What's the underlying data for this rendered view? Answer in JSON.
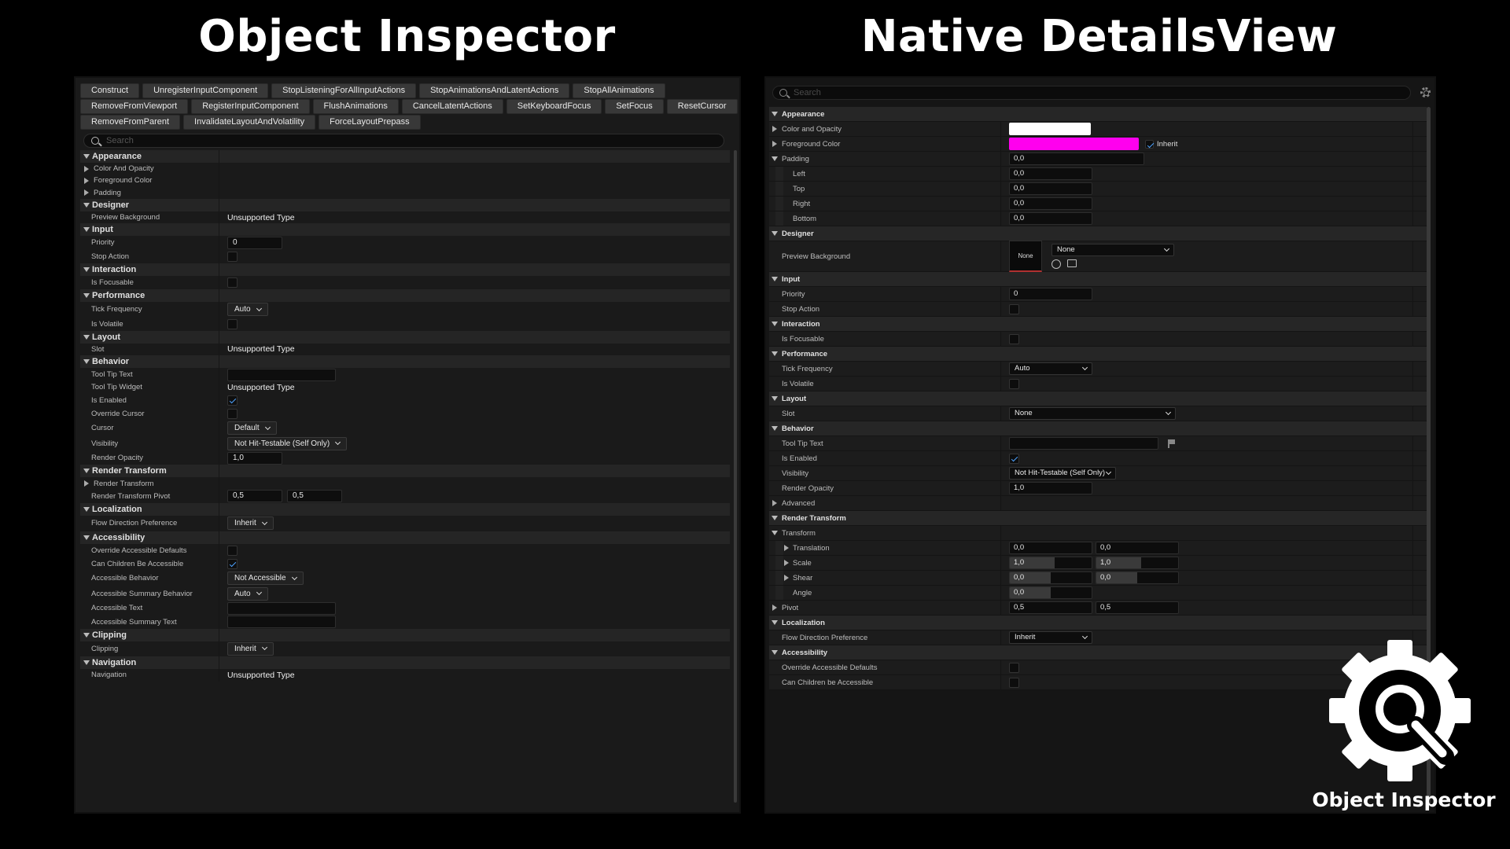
{
  "titles": {
    "left": "Object Inspector",
    "right": "Native DetailsView"
  },
  "object_inspector": {
    "function_buttons": [
      [
        "Construct",
        "UnregisterInputComponent",
        "StopListeningForAllInputActions",
        "StopAnimationsAndLatentActions",
        "StopAllAnimations"
      ],
      [
        "RemoveFromViewport",
        "RegisterInputComponent",
        "FlushAnimations",
        "CancelLatentActions",
        "SetKeyboardFocus",
        "SetFocus",
        "ResetCursor"
      ],
      [
        "RemoveFromParent",
        "InvalidateLayoutAndVolatility",
        "ForceLayoutPrepass"
      ]
    ],
    "search_placeholder": "Search",
    "rows": [
      {
        "type": "cat",
        "label": "Appearance"
      },
      {
        "type": "sub",
        "label": "Color And Opacity"
      },
      {
        "type": "sub",
        "label": "Foreground Color"
      },
      {
        "type": "sub",
        "label": "Padding"
      },
      {
        "type": "cat",
        "label": "Designer"
      },
      {
        "type": "text",
        "label": "Preview Background",
        "value": "Unsupported Type"
      },
      {
        "type": "cat",
        "label": "Input"
      },
      {
        "type": "input",
        "label": "Priority",
        "value": "0",
        "w": 70
      },
      {
        "type": "check",
        "label": "Stop Action",
        "on": false
      },
      {
        "type": "cat",
        "label": "Interaction"
      },
      {
        "type": "check",
        "label": "Is Focusable",
        "on": false
      },
      {
        "type": "cat",
        "label": "Performance"
      },
      {
        "type": "combo",
        "label": "Tick Frequency",
        "value": "Auto"
      },
      {
        "type": "check",
        "label": "Is Volatile",
        "on": false
      },
      {
        "type": "cat",
        "label": "Layout"
      },
      {
        "type": "text",
        "label": "Slot",
        "value": "Unsupported Type"
      },
      {
        "type": "cat",
        "label": "Behavior"
      },
      {
        "type": "input",
        "label": "Tool Tip Text",
        "value": "",
        "w": 138
      },
      {
        "type": "text",
        "label": "Tool Tip Widget",
        "value": "Unsupported Type"
      },
      {
        "type": "check",
        "label": "Is Enabled",
        "on": true
      },
      {
        "type": "check",
        "label": "Override Cursor",
        "on": false
      },
      {
        "type": "combo",
        "label": "Cursor",
        "value": "Default"
      },
      {
        "type": "combo",
        "label": "Visibility",
        "value": "Not Hit-Testable (Self Only)"
      },
      {
        "type": "input",
        "label": "Render Opacity",
        "value": "1,0",
        "w": 70
      },
      {
        "type": "cat",
        "label": "Render Transform"
      },
      {
        "type": "sub",
        "label": "Render Transform"
      },
      {
        "type": "pair",
        "label": "Render Transform Pivot",
        "values": [
          "0,5",
          "0,5"
        ]
      },
      {
        "type": "cat",
        "label": "Localization"
      },
      {
        "type": "combo",
        "label": "Flow Direction Preference",
        "value": "Inherit"
      },
      {
        "type": "cat",
        "label": "Accessibility"
      },
      {
        "type": "check",
        "label": "Override Accessible Defaults",
        "on": false
      },
      {
        "type": "check",
        "label": "Can Children Be Accessible",
        "on": true
      },
      {
        "type": "combo",
        "label": "Accessible Behavior",
        "value": "Not Accessible"
      },
      {
        "type": "combo",
        "label": "Accessible Summary Behavior",
        "value": "Auto"
      },
      {
        "type": "input",
        "label": "Accessible Text",
        "value": "",
        "w": 138
      },
      {
        "type": "input",
        "label": "Accessible Summary Text",
        "value": "",
        "w": 138
      },
      {
        "type": "cat",
        "label": "Clipping"
      },
      {
        "type": "combo",
        "label": "Clipping",
        "value": "Inherit"
      },
      {
        "type": "cat",
        "label": "Navigation"
      },
      {
        "type": "text",
        "label": "Navigation",
        "value": "Unsupported Type"
      }
    ]
  },
  "details_view": {
    "search_placeholder": "Search",
    "rows": [
      {
        "type": "cat",
        "label": "Appearance"
      },
      {
        "type": "swatch",
        "label": "Color and Opacity",
        "color": "#ffffff"
      },
      {
        "type": "swatch",
        "label": "Foreground Color",
        "color": "#ff00ee",
        "inherit_label": "Inherit",
        "inherit_on": true
      },
      {
        "type": "input",
        "label": "Padding",
        "value": "0,0",
        "w": 172,
        "expanded": true
      },
      {
        "type": "input",
        "label": "Left",
        "value": "0,0",
        "w": 106,
        "indent": true
      },
      {
        "type": "input",
        "label": "Top",
        "value": "0,0",
        "w": 106,
        "indent": true
      },
      {
        "type": "input",
        "label": "Right",
        "value": "0,0",
        "w": 106,
        "indent": true
      },
      {
        "type": "input",
        "label": "Bottom",
        "value": "0,0",
        "w": 106,
        "indent": true
      },
      {
        "type": "cat",
        "label": "Designer"
      },
      {
        "type": "asset",
        "label": "Preview Background",
        "thumb": "None",
        "value": "None"
      },
      {
        "type": "cat",
        "label": "Input"
      },
      {
        "type": "input",
        "label": "Priority",
        "value": "0",
        "w": 106
      },
      {
        "type": "check",
        "label": "Stop Action",
        "on": false
      },
      {
        "type": "cat",
        "label": "Interaction"
      },
      {
        "type": "check",
        "label": "Is Focusable",
        "on": false
      },
      {
        "type": "cat",
        "label": "Performance"
      },
      {
        "type": "combo",
        "label": "Tick Frequency",
        "value": "Auto",
        "w": 106
      },
      {
        "type": "check",
        "label": "Is Volatile",
        "on": false
      },
      {
        "type": "cat",
        "label": "Layout"
      },
      {
        "type": "combo",
        "label": "Slot",
        "value": "None",
        "w": 212
      },
      {
        "type": "cat",
        "label": "Behavior"
      },
      {
        "type": "flaginput",
        "label": "Tool Tip Text",
        "value": "",
        "w": 190
      },
      {
        "type": "check",
        "label": "Is Enabled",
        "on": true
      },
      {
        "type": "combo",
        "label": "Visibility",
        "value": "Not Hit-Testable (Self Only)",
        "w": 136
      },
      {
        "type": "input",
        "label": "Render Opacity",
        "value": "1,0",
        "w": 106
      },
      {
        "type": "collapsed",
        "label": "Advanced"
      },
      {
        "type": "cat",
        "label": "Render Transform"
      },
      {
        "type": "header",
        "label": "Transform"
      },
      {
        "type": "pair",
        "label": "Translation",
        "values": [
          "0,0",
          "0,0"
        ],
        "fills": [
          0,
          0
        ],
        "indent": true,
        "arrow": true
      },
      {
        "type": "pair",
        "label": "Scale",
        "values": [
          "1,0",
          "1,0"
        ],
        "fills": [
          0.55,
          0.55
        ],
        "indent": true,
        "arrow": true
      },
      {
        "type": "pair",
        "label": "Shear",
        "values": [
          "0,0",
          "0,0"
        ],
        "fills": [
          0.5,
          0.5
        ],
        "indent": true,
        "arrow": true
      },
      {
        "type": "single",
        "label": "Angle",
        "value": "0,0",
        "fill": 0.5,
        "indent": true
      },
      {
        "type": "pair",
        "label": "Pivot",
        "values": [
          "0,5",
          "0,5"
        ],
        "fills": [
          0,
          0
        ],
        "arrow": true
      },
      {
        "type": "cat",
        "label": "Localization"
      },
      {
        "type": "combo",
        "label": "Flow Direction Preference",
        "value": "Inherit",
        "w": 106
      },
      {
        "type": "cat",
        "label": "Accessibility"
      },
      {
        "type": "check",
        "label": "Override Accessible Defaults",
        "on": false
      },
      {
        "type": "check",
        "label": "Can Children be Accessible",
        "on": false
      }
    ]
  },
  "logo": {
    "label": "Object Inspector"
  }
}
